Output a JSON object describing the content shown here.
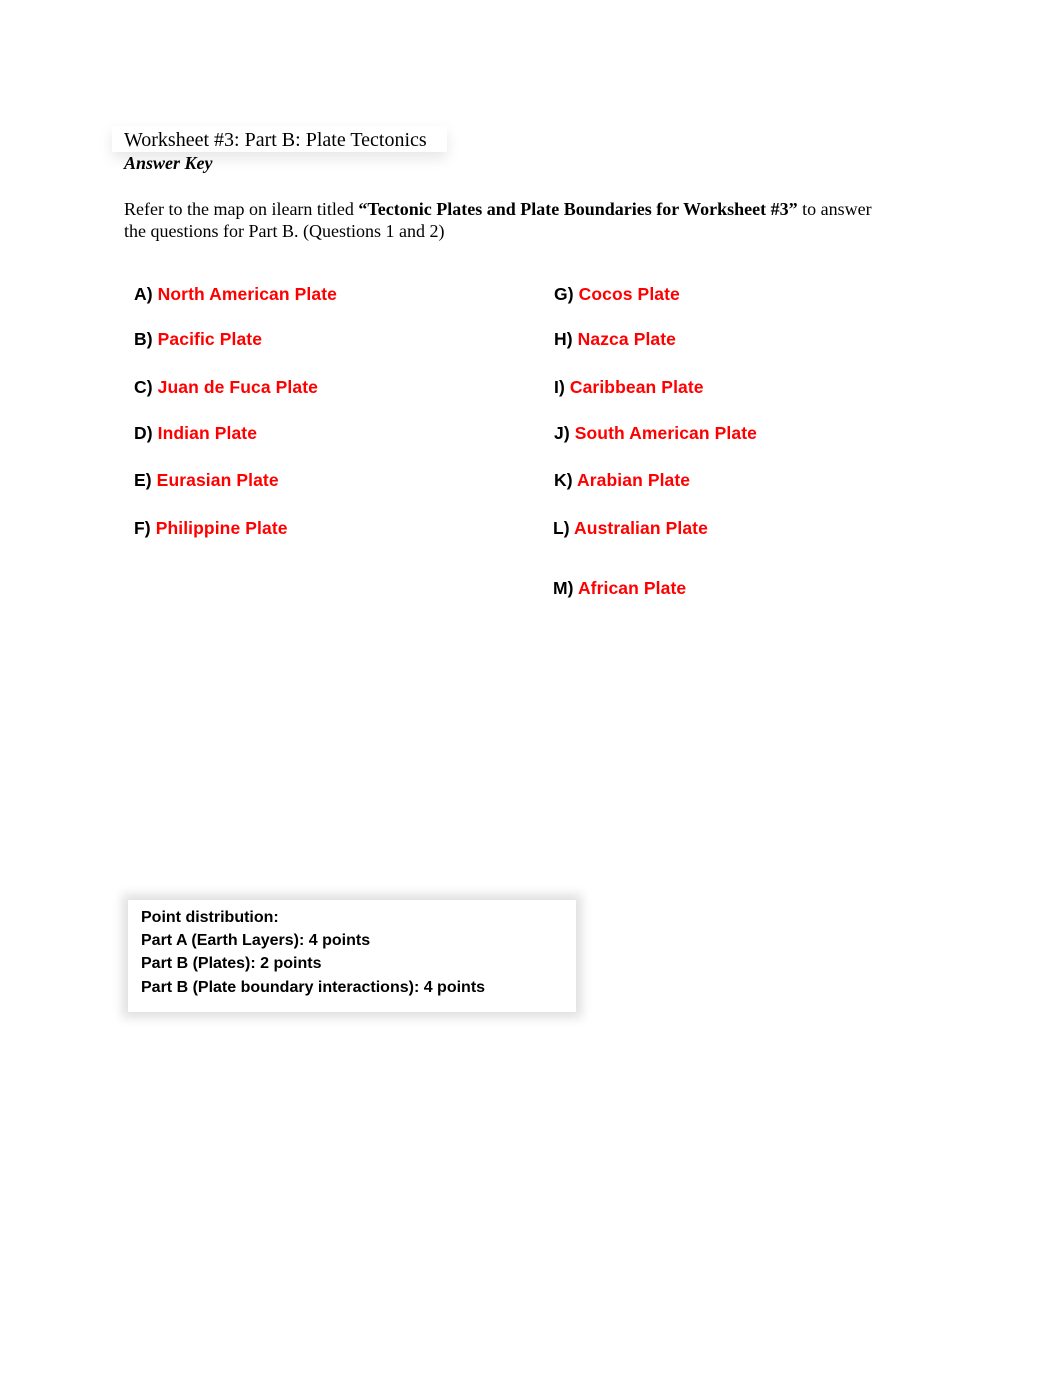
{
  "document": {
    "title": "Worksheet #3: Part B: Plate Tectonics",
    "subtitle": "Answer Key",
    "intro": {
      "prefix": "Refer to the map on ilearn titled ",
      "bold_title": "“Tectonic Plates and Plate Boundaries for Worksheet #3”",
      "suffix_line1": " to answer",
      "line2": "the questions for Part B. (Questions 1 and 2)"
    },
    "answer_color": "#ff0000",
    "answers_left": [
      {
        "letter": "A)",
        "value": "North American Plate"
      },
      {
        "letter": "B)",
        "value": "Pacific Plate"
      },
      {
        "letter": "C)",
        "value": "Juan de Fuca Plate"
      },
      {
        "letter": "D)",
        "value": "Indian Plate"
      },
      {
        "letter": "E)",
        "value": "Eurasian Plate"
      },
      {
        "letter": "F)",
        "value": "Philippine Plate"
      }
    ],
    "answers_right": [
      {
        "letter": "G)",
        "value": "Cocos Plate"
      },
      {
        "letter": "H)",
        "value": "Nazca Plate"
      },
      {
        "letter": "I)",
        "value": "Caribbean Plate"
      },
      {
        "letter": "J)",
        "value": "South American Plate"
      },
      {
        "letter": "K)",
        "value": "Arabian Plate"
      },
      {
        "letter": "L)",
        "value": "Australian Plate"
      },
      {
        "letter": "M)",
        "value": "African Plate"
      }
    ],
    "point_distribution": {
      "heading": "Point distribution:",
      "lines": [
        "Part A (Earth Layers): 4 points",
        "Part B (Plates): 2 points",
        "Part B (Plate boundary interactions): 4 points"
      ]
    }
  }
}
